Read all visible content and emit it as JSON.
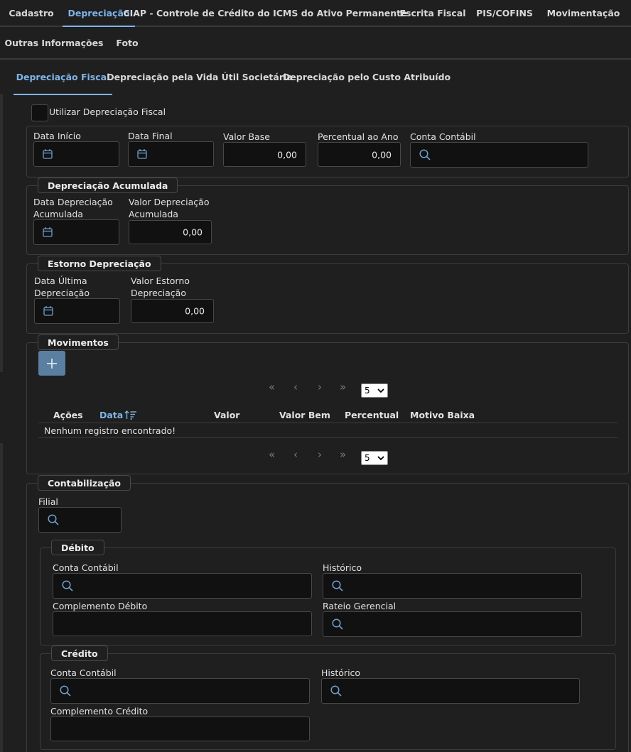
{
  "tabs_row1": [
    {
      "label": "Cadastro"
    },
    {
      "label": "Depreciação"
    },
    {
      "label": "CIAP - Controle de Crédito do ICMS do Ativo Permanente"
    },
    {
      "label": "Escrita Fiscal"
    },
    {
      "label": "PIS/COFINS"
    },
    {
      "label": "Movimentação"
    }
  ],
  "tabs_row2": [
    {
      "label": "Outras Informações"
    },
    {
      "label": "Foto"
    }
  ],
  "subtabs": [
    {
      "label": "Depreciação Fiscal"
    },
    {
      "label": "Depreciação pela Vida Útil Societária"
    },
    {
      "label": "Depreciação pelo Custo Atribuído"
    }
  ],
  "fiscal": {
    "use_label": "Utilizar Depreciação Fiscal",
    "data_inicio": "Data Início",
    "data_final": "Data Final",
    "valor_base": "Valor Base",
    "valor_base_value": "0,00",
    "percentual": "Percentual ao Ano",
    "percentual_value": "0,00",
    "conta": "Conta Contábil"
  },
  "acumulada": {
    "legend": "Depreciação Acumulada",
    "data_l1": "Data Depreciação",
    "data_l2": "Acumulada",
    "valor_l1": "Valor Depreciação",
    "valor_l2": "Acumulada",
    "valor_value": "0,00"
  },
  "estorno": {
    "legend": "Estorno Depreciação",
    "data_l1": "Data Última",
    "data_l2": "Depreciação",
    "valor_l1": "Valor Estorno",
    "valor_l2": "Depreciação",
    "valor_value": "0,00"
  },
  "movimentos": {
    "legend": "Movimentos",
    "page_size": "5",
    "columns": {
      "acoes": "Ações",
      "data": "Data",
      "valor": "Valor",
      "valor_bem": "Valor Bem",
      "percentual": "Percentual",
      "motivo": "Motivo Baixa"
    },
    "empty": "Nenhum registro encontrado!"
  },
  "contabilizacao": {
    "legend": "Contabilização",
    "filial": "Filial",
    "debito": {
      "legend": "Débito",
      "conta": "Conta Contábil",
      "historico": "Histórico",
      "complemento": "Complemento Débito",
      "rateio": "Rateio Gerencial"
    },
    "credito": {
      "legend": "Crédito",
      "conta": "Conta Contábil",
      "historico": "Histórico",
      "complemento": "Complemento Crédito"
    }
  },
  "colors": {
    "accent": "#7fb4ea",
    "background": "#1f1f1f",
    "input_bg": "#111111",
    "add_button": "#5a7fa1"
  },
  "icons": {
    "calendar": "calendar-icon",
    "search": "search-icon",
    "add": "plus-icon",
    "sort": "sort-ascending-icon"
  }
}
